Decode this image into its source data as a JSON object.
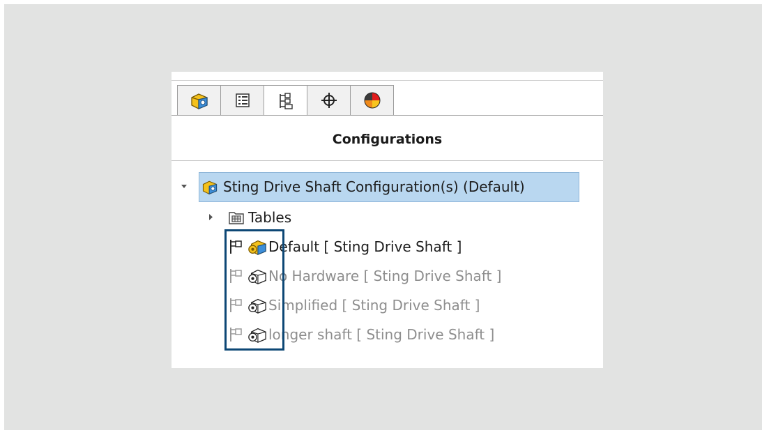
{
  "panel": {
    "title": "Configurations",
    "tabs": [
      {
        "name": "FeatureManager",
        "icon": "part-cube-icon",
        "active": false
      },
      {
        "name": "PropertyManager",
        "icon": "property-list-icon",
        "active": false
      },
      {
        "name": "ConfigurationManager",
        "icon": "configuration-tree-icon",
        "active": true
      },
      {
        "name": "DimXpertManager",
        "icon": "crosshair-icon",
        "active": false
      },
      {
        "name": "DisplayManager",
        "icon": "display-pie-icon",
        "active": false
      }
    ]
  },
  "tree": {
    "root_label": "Sting Drive Shaft Configuration(s)  (Default)",
    "tables_label": "Tables",
    "configs": [
      {
        "label": "Default [ Sting Drive Shaft ]",
        "active": true
      },
      {
        "label": "No Hardware [ Sting Drive Shaft ]",
        "active": false
      },
      {
        "label": "Simplified [ Sting Drive Shaft ]",
        "active": false
      },
      {
        "label": "longer shaft [ Sting Drive Shaft ]",
        "active": false
      }
    ]
  },
  "colors": {
    "selection_fill": "#b9d7f0",
    "highlight_box": "#0d4775",
    "inactive_text": "#8e8e8e"
  }
}
